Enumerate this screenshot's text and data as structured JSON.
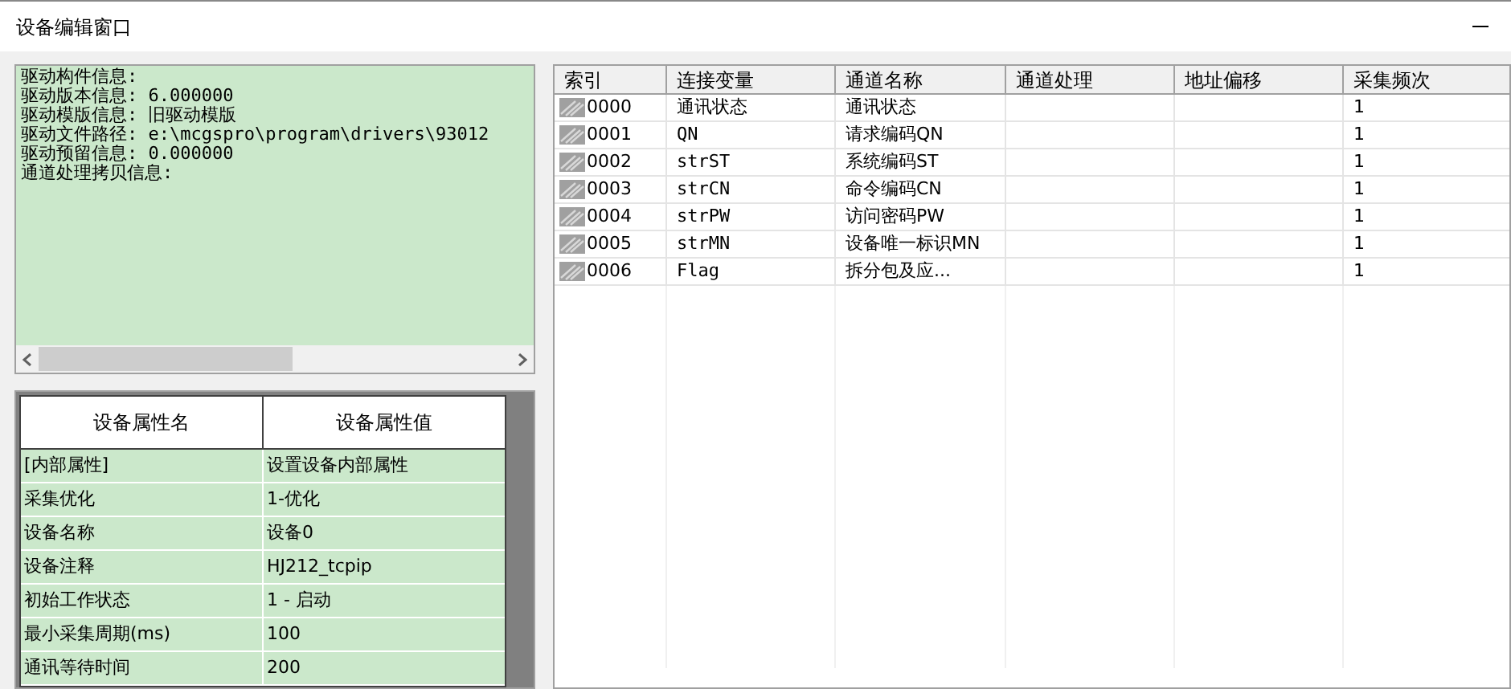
{
  "window": {
    "title": "设备编辑窗口"
  },
  "driver_info": {
    "lines": [
      "驱动构件信息:",
      "驱动版本信息: 6.000000",
      "驱动模版信息: 旧驱动模版",
      "驱动文件路径: e:\\mcgspro\\program\\drivers\\93012",
      "驱动预留信息: 0.000000",
      "通道处理拷贝信息:"
    ]
  },
  "property_table": {
    "columns": [
      "设备属性名",
      "设备属性值"
    ],
    "rows": [
      [
        "[内部属性]",
        "设置设备内部属性"
      ],
      [
        "采集优化",
        "1-优化"
      ],
      [
        "设备名称",
        "设备0"
      ],
      [
        "设备注释",
        "HJ212_tcpip"
      ],
      [
        "初始工作状态",
        "1 - 启动"
      ],
      [
        "最小采集周期(ms)",
        "100"
      ],
      [
        "通讯等待时间",
        "200"
      ]
    ]
  },
  "channel_table": {
    "columns": [
      "索引",
      "连接变量",
      "通道名称",
      "通道处理",
      "地址偏移",
      "采集频次"
    ],
    "rows": [
      {
        "index": "0000",
        "variable": "通讯状态",
        "channel_name": "通讯状态",
        "frequency": "1"
      },
      {
        "index": "0001",
        "variable": "QN",
        "channel_name": "请求编码QN",
        "frequency": "1"
      },
      {
        "index": "0002",
        "variable": "strST",
        "channel_name": "系统编码ST",
        "frequency": "1"
      },
      {
        "index": "0003",
        "variable": "strCN",
        "channel_name": "命令编码CN",
        "frequency": "1"
      },
      {
        "index": "0004",
        "variable": "strPW",
        "channel_name": "访问密码PW",
        "frequency": "1"
      },
      {
        "index": "0005",
        "variable": "strMN",
        "channel_name": "设备唯一标识MN",
        "frequency": "1"
      },
      {
        "index": "0006",
        "variable": "Flag",
        "channel_name": "拆分包及应...",
        "frequency": "1"
      }
    ]
  }
}
